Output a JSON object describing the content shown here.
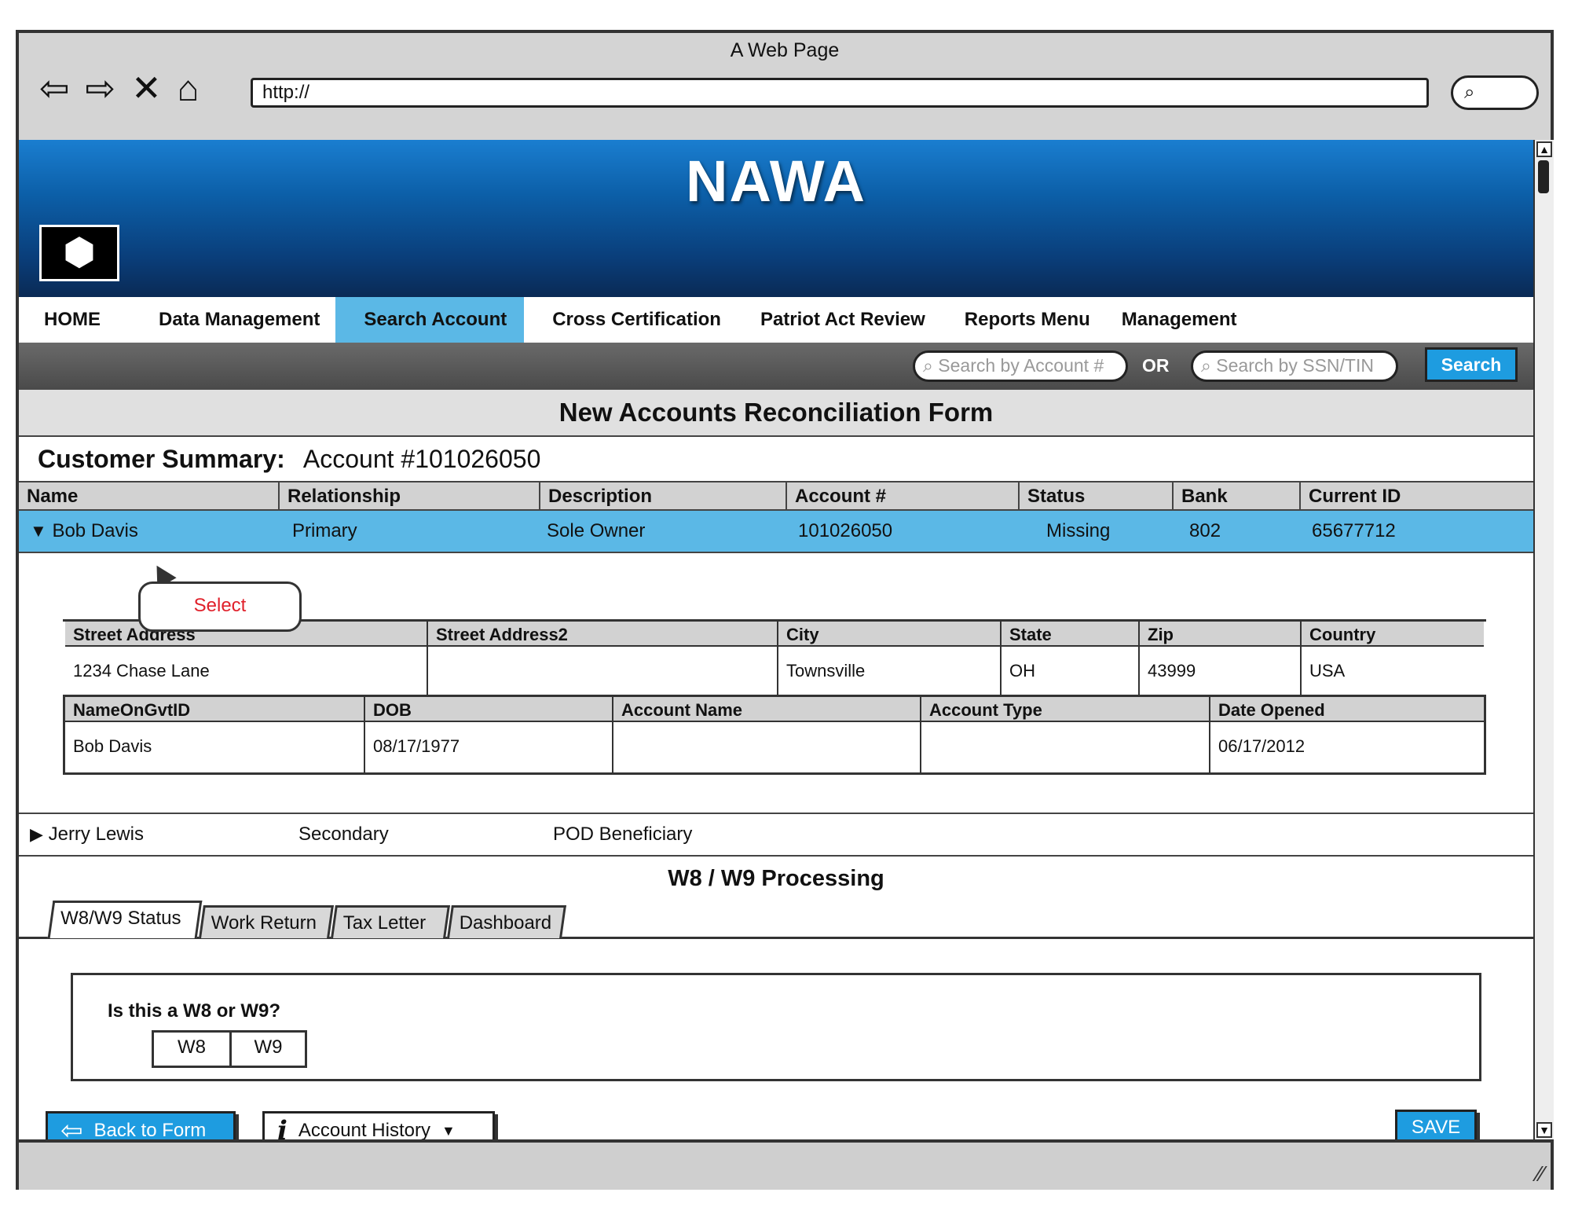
{
  "browser": {
    "title": "A Web Page",
    "url": "http://",
    "search_icon": "search-icon"
  },
  "banner": {
    "title": "NAWA"
  },
  "nav": {
    "items": [
      {
        "label": "HOME"
      },
      {
        "label": "Data Management"
      },
      {
        "label": "Search Account",
        "active": true
      },
      {
        "label": "Cross Certification"
      },
      {
        "label": "Patriot Act Review"
      },
      {
        "label": "Reports Menu"
      },
      {
        "label": "Management"
      }
    ]
  },
  "search": {
    "account_placeholder": "Search by Account #",
    "or_label": "OR",
    "ssn_placeholder": "Search by SSN/TIN",
    "button_label": "Search"
  },
  "form": {
    "title": "New Accounts Reconciliation Form"
  },
  "summary": {
    "label": "Customer Summary:",
    "account": "Account #101026050"
  },
  "customers": {
    "headers": [
      "Name",
      "Relationship",
      "Description",
      "Account #",
      "Status",
      "Bank",
      "Current ID"
    ],
    "rows": [
      {
        "name": "Bob Davis",
        "relationship": "Primary",
        "description": "Sole Owner",
        "account": "101026050",
        "status": "Missing",
        "bank": "802",
        "current_id": "65677712"
      },
      {
        "name": "Jerry Lewis",
        "relationship": "Secondary",
        "description": "POD Beneficiary"
      }
    ]
  },
  "callout": {
    "label": "Select"
  },
  "details": {
    "address_headers": [
      "Street Address",
      "Street Address2",
      "City",
      "State",
      "Zip",
      "Country"
    ],
    "address_values": [
      "1234 Chase Lane",
      "",
      "Townsville",
      "OH",
      "43999",
      "USA"
    ],
    "id_headers": [
      "NameOnGvtID",
      "DOB",
      "Account Name",
      "Account Type",
      "Date Opened"
    ],
    "id_values": [
      "Bob Davis",
      "08/17/1977",
      "",
      "",
      "06/17/2012"
    ]
  },
  "processing": {
    "title": "W8 / W9 Processing",
    "tabs": [
      "W8/W9 Status",
      "Work Return",
      "Tax Letter",
      "Dashboard"
    ],
    "question": "Is this a W8 or W9?",
    "options": [
      "W8",
      "W9"
    ]
  },
  "actions": {
    "back_label": "Back to Form",
    "history_label": "Account History",
    "save_label": "SAVE"
  },
  "colors": {
    "accent": "#1e9ce0",
    "selected_row": "#5bb8e6",
    "callout_text": "#e0202a"
  }
}
